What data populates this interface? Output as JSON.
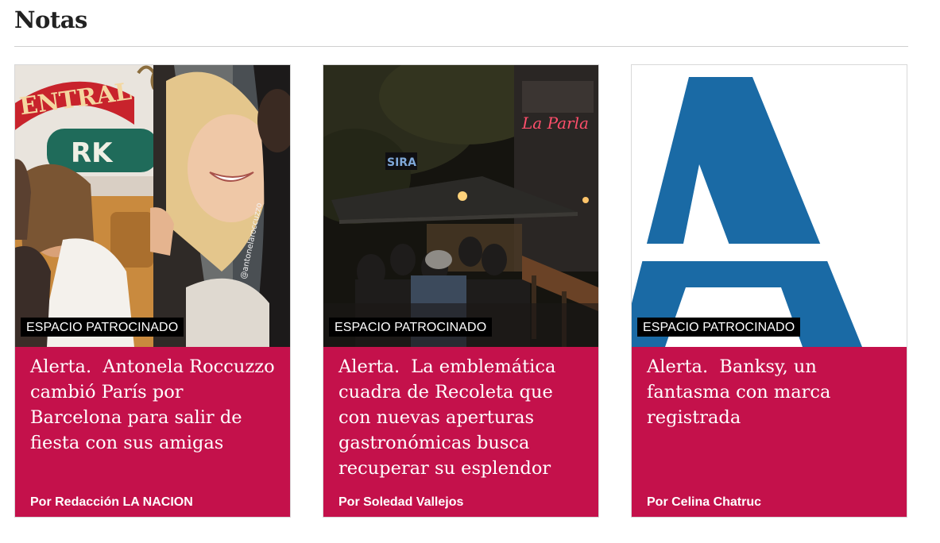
{
  "section": {
    "title": "Notas"
  },
  "cards": [
    {
      "badge": "ESPACIO PATROCINADO",
      "kicker": "Alerta.",
      "headline": "Antonela Roccuzzo cambió París por Barcelona para salir de fiesta con sus amigas",
      "byline": "Por Redacción LA NACION",
      "image_text": {
        "sign": "ENTRAL",
        "sign2": "RK",
        "watermark": "@antonelaroccuzzo"
      }
    },
    {
      "badge": "ESPACIO PATROCINADO",
      "kicker": "Alerta.",
      "headline": "La emblemática cuadra de Recoleta que con nuevas aperturas gastronómicas busca recuperar su esplendor",
      "byline": "Por Soledad Vallejos",
      "image_text": {
        "neon": "La Parla",
        "sign": "SIRA"
      }
    },
    {
      "badge": "ESPACIO PATROCINADO",
      "kicker": "Alerta.",
      "headline": "Banksy, un fantasma con marca registrada",
      "byline": "Por Celina Chatruc",
      "image_text": {
        "logo_letter": "A"
      }
    }
  ],
  "colors": {
    "card_bg": "#c4114b",
    "badge_bg": "#000000",
    "logo_blue": "#1a6aa5"
  }
}
